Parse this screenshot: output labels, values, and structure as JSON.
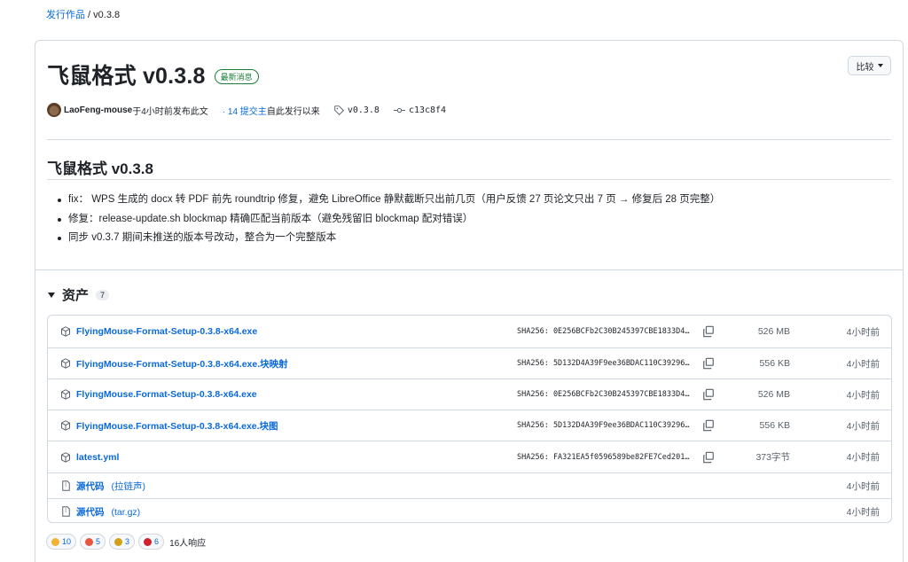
{
  "breadcrumb": {
    "releases_link": "发行作品",
    "separator": " / ",
    "current": "v0.3.8"
  },
  "release": {
    "title": "飞鼠格式 v0.3.8",
    "latest_badge": "最新消息",
    "compare_label": "比较",
    "author": "LaoFeng-mouse",
    "published_text": "于4小时前发布此文",
    "commits_link": "· 14 提交主",
    "commits_suffix": " 自此发行以来",
    "tag": "v0.3.8",
    "commit": "c13c8f4"
  },
  "notes": {
    "heading": "飞鼠格式 v0.3.8",
    "items": [
      "fix： WPS 生成的 docx 转 PDF 前先 roundtrip 修复，避免 LibreOffice 静默截断只出前几页（用户反馈 27 页论文只出 7 页 → 修复后 28 页完整）",
      "修复：release-update.sh blockmap 精确匹配当前版本（避免残留旧 blockmap 配对错误）",
      "同步 v0.3.7 期间未推送的版本号改动，整合为一个完整版本"
    ]
  },
  "assets": {
    "heading": "资产",
    "count": "7",
    "rows": [
      {
        "name": "FlyingMouse-Format-Setup-0.3.8-x64.exe",
        "sha": "SHA256: 0E256BCFb2C30B245397CBE1833D4…",
        "size": "526 MB",
        "time": "4小时前"
      },
      {
        "name": "FlyingMouse-Format-Setup-0.3.8-x64.exe.块映射",
        "sha": "SHA256: 5D132D4A39F9ee36BDAC110C39296…",
        "size": "556 KB",
        "time": "4小时前"
      },
      {
        "name": "FlyingMouse.Format-Setup-0.3.8-x64.exe",
        "sha": "SHA256: 0E256BCFb2C30B245397CBE1833D4…",
        "size": "526 MB",
        "time": "4小时前"
      },
      {
        "name": "FlyingMouse.Format-Setup-0.3.8-x64.exe.块图",
        "sha": "SHA256: 5D132D4A39F9ee36BDAC110C39296…",
        "size": "556 KB",
        "time": "4小时前"
      },
      {
        "name": "latest.yml",
        "sha": "SHA256: FA321EA5f0596589be82FE7Ced201…",
        "size": "373字节",
        "time": "4小时前"
      }
    ],
    "source_rows": [
      {
        "name": "源代码",
        "format": "(拉链声)",
        "time": "4小时前"
      },
      {
        "name": "源代码",
        "format": "(tar.gz)",
        "time": "4小时前"
      }
    ]
  },
  "reactions": {
    "items": [
      {
        "emoji": "thumbs-up",
        "count": "10",
        "color": "#f2b233"
      },
      {
        "emoji": "laugh",
        "count": "5",
        "color": "#e8563f"
      },
      {
        "emoji": "hooray",
        "count": "3",
        "color": "#d4a017"
      },
      {
        "emoji": "heart",
        "count": "6",
        "color": "#cf222e"
      }
    ],
    "total": "16人响应"
  }
}
